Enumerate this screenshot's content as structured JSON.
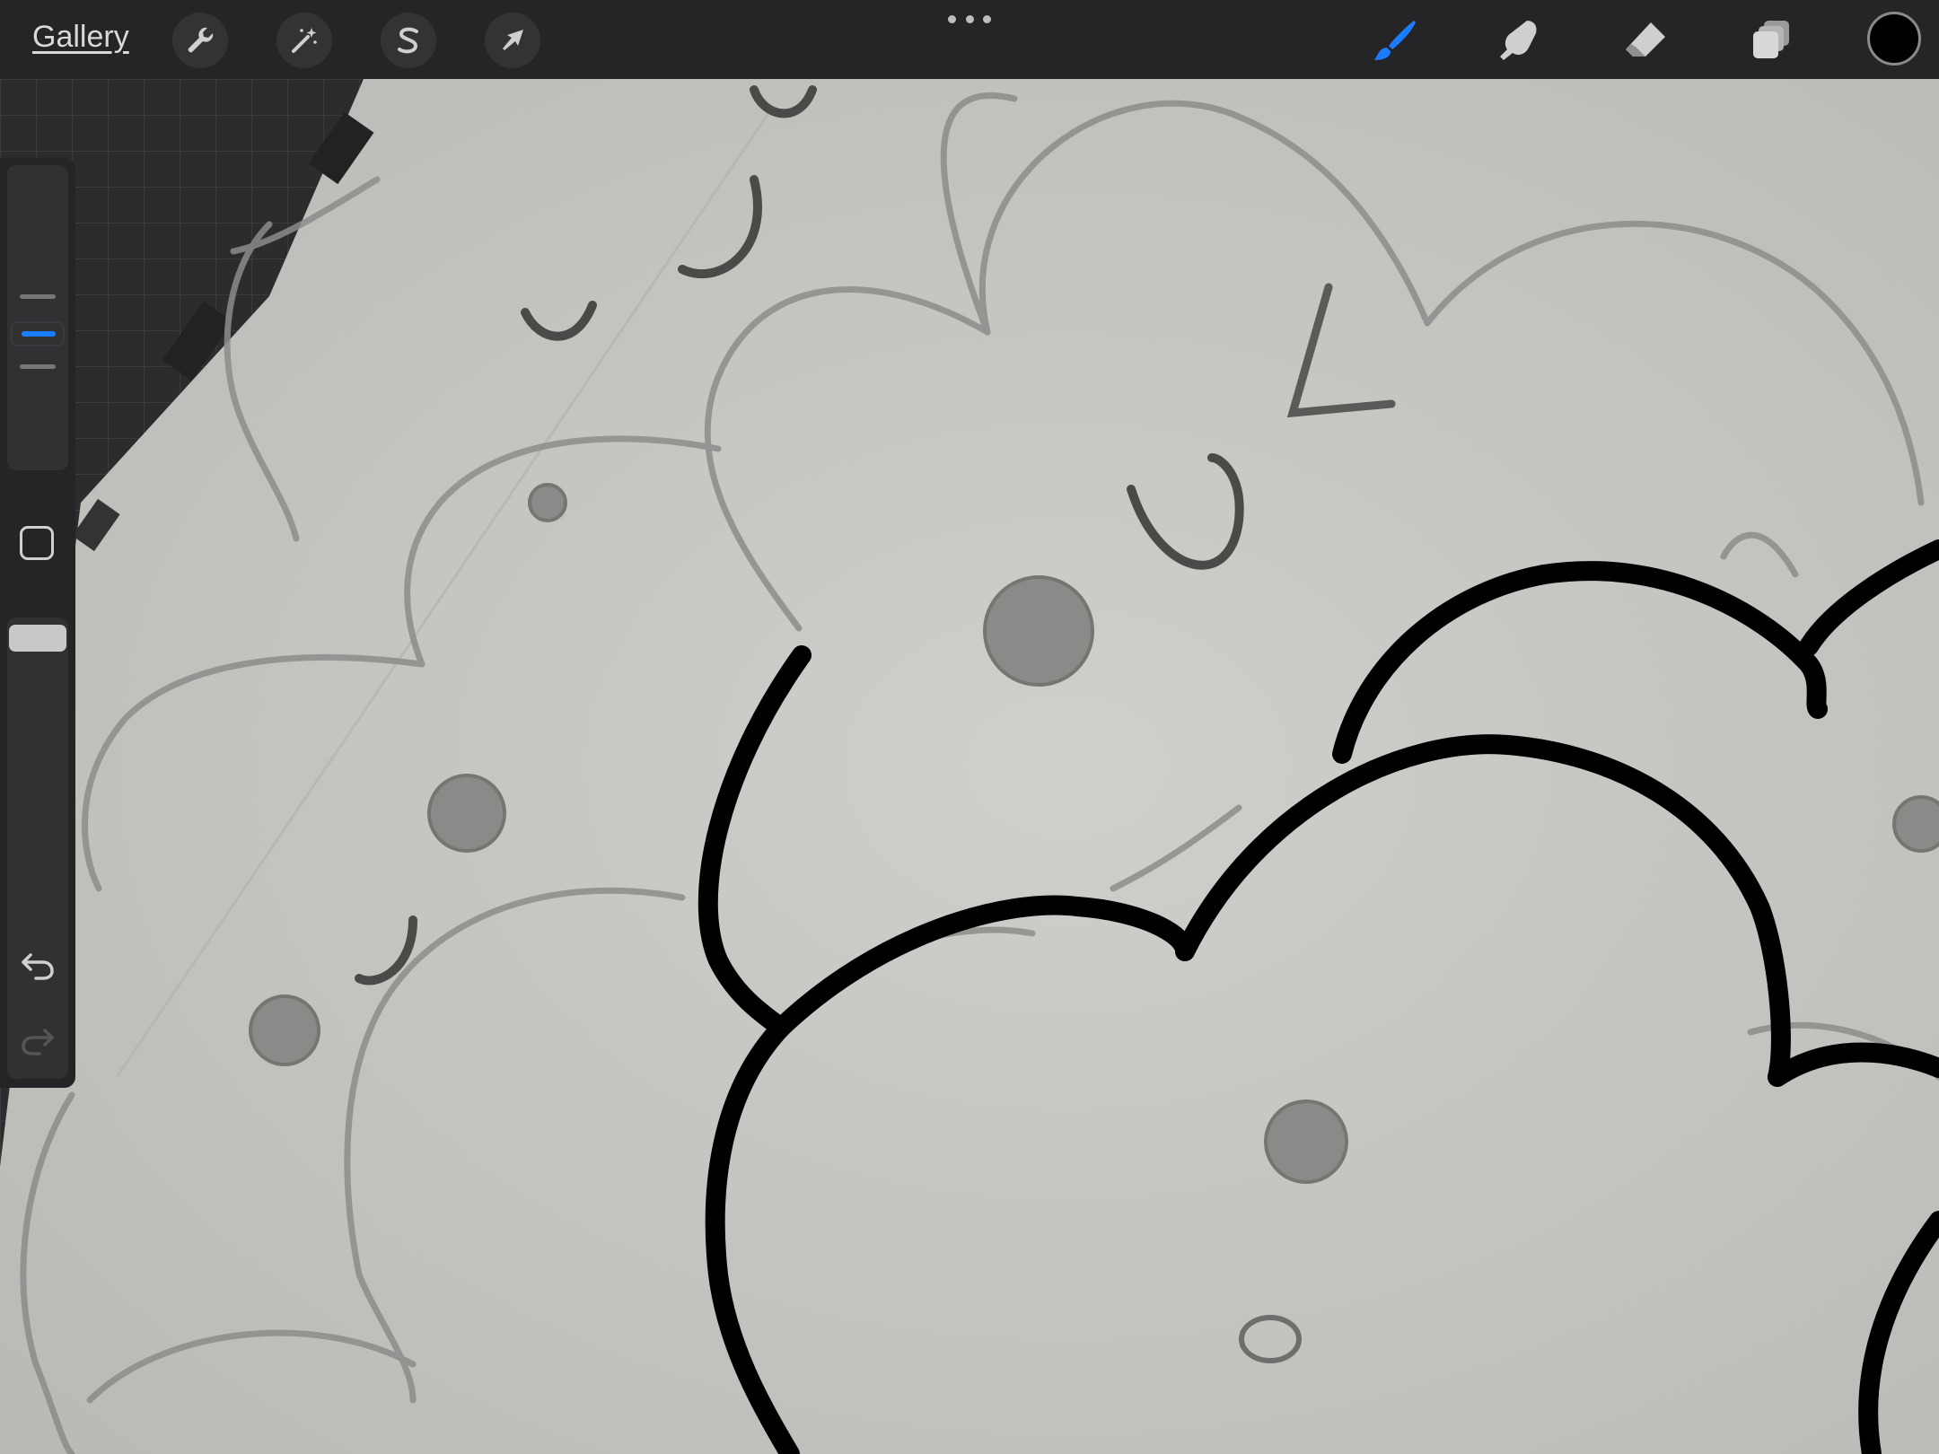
{
  "toolbar": {
    "gallery_label": "Gallery",
    "left_tools": [
      {
        "name": "actions",
        "icon": "wrench-icon"
      },
      {
        "name": "adjustments",
        "icon": "magic-wand-icon"
      },
      {
        "name": "selection",
        "icon": "selection-s-icon"
      },
      {
        "name": "transform",
        "icon": "arrow-cursor-icon"
      }
    ],
    "right_tools": [
      {
        "name": "brush",
        "icon": "brush-icon",
        "active": true
      },
      {
        "name": "smudge",
        "icon": "smudge-finger-icon",
        "active": false
      },
      {
        "name": "eraser",
        "icon": "eraser-icon",
        "active": false
      },
      {
        "name": "layers",
        "icon": "layers-icon",
        "active": false
      }
    ],
    "current_color": "#000000",
    "active_color": "#1a7cff"
  },
  "sidebar": {
    "brush_size_level": 0.5,
    "opacity_level": 1.0,
    "undo_icon": "undo-icon",
    "redo_icon": "redo-icon"
  }
}
